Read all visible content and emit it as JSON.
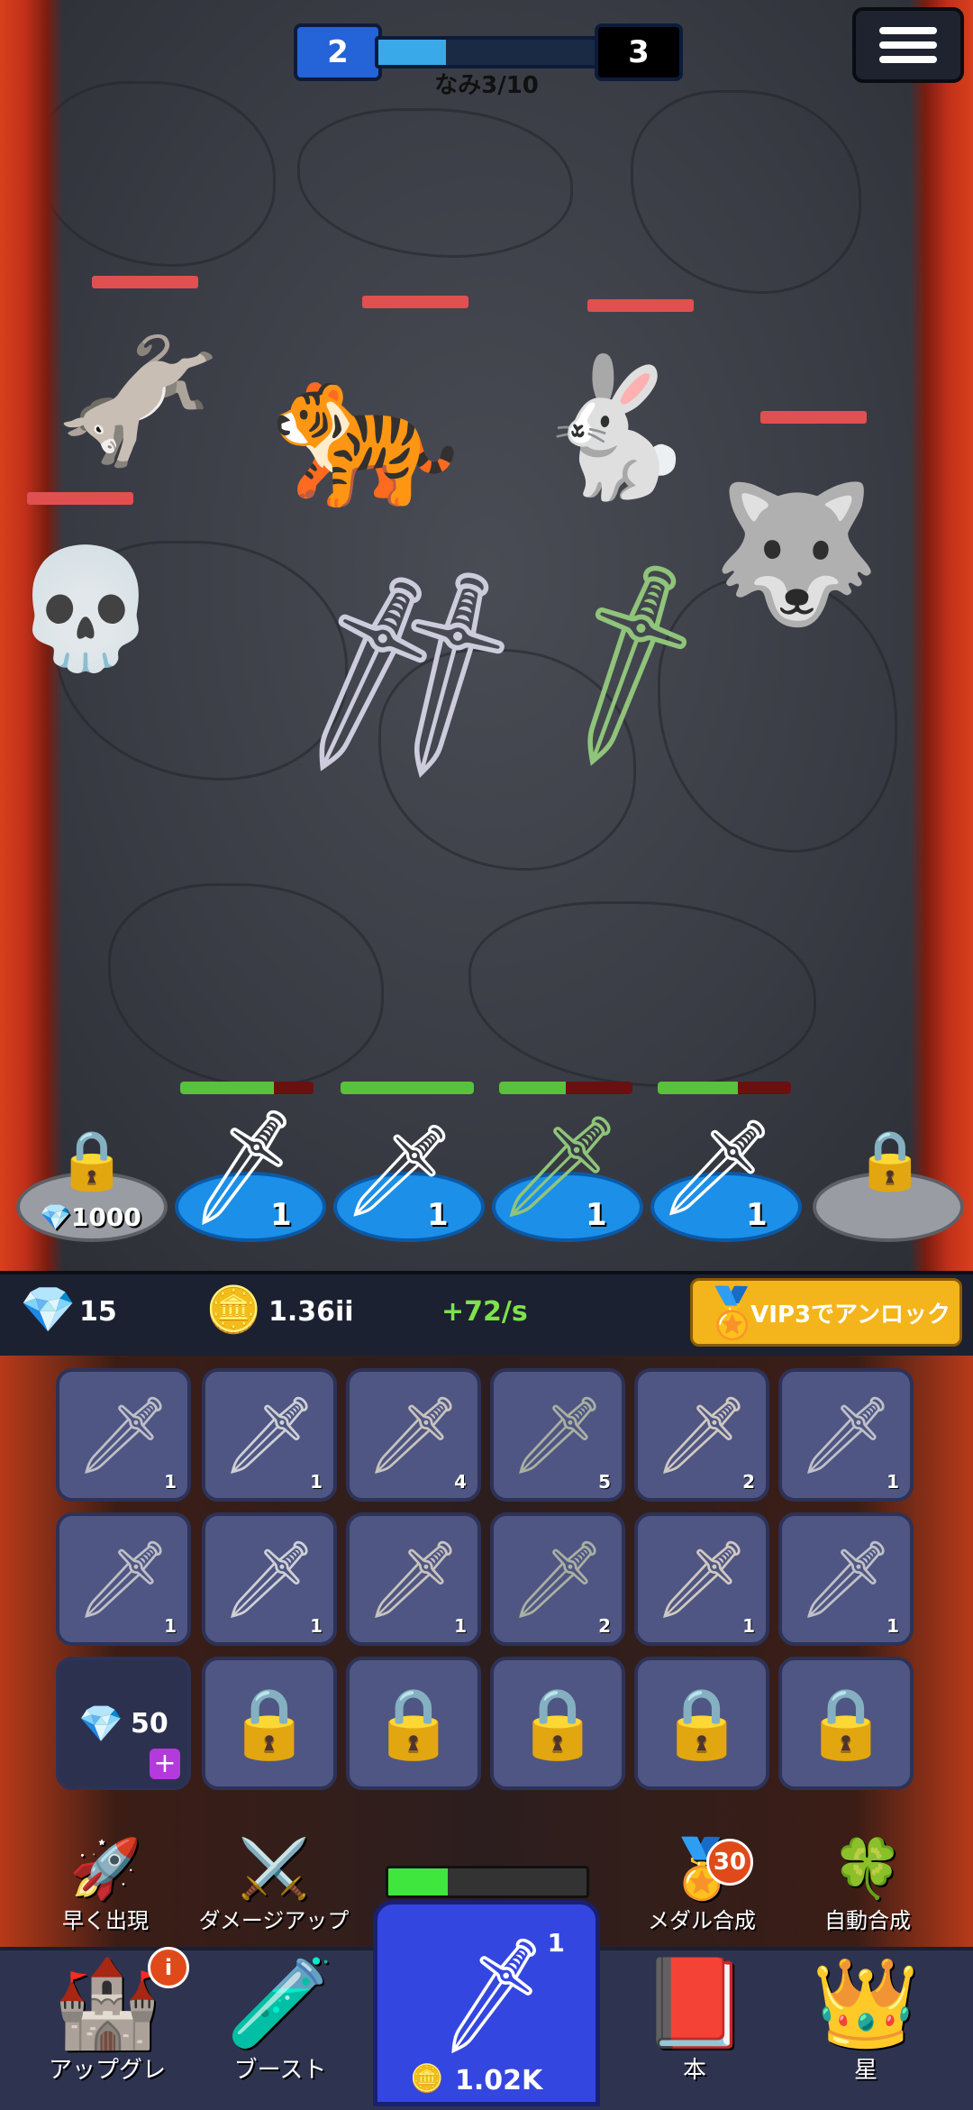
{
  "wave": {
    "current_level": "2",
    "next_level": "3",
    "label": "なみ3/10",
    "progress": 0.3
  },
  "enemies": [
    {
      "name": "donkey",
      "icon": "donkey-icon",
      "hp": 1.0
    },
    {
      "name": "sabertooth-tiger",
      "icon": "tiger-icon",
      "hp": 1.0
    },
    {
      "name": "rabbit",
      "icon": "rabbit-icon",
      "hp": 1.0
    },
    {
      "name": "wolf",
      "icon": "wolf-icon",
      "hp": 1.0
    },
    {
      "name": "viking-skeleton",
      "icon": "skeleton-icon",
      "hp": 1.0
    }
  ],
  "slots": [
    {
      "state": "locked",
      "price": "1000",
      "currency": "gem"
    },
    {
      "state": "weapon",
      "level": "1",
      "hp": 0.7
    },
    {
      "state": "weapon",
      "level": "1",
      "hp": 1.0
    },
    {
      "state": "weapon",
      "level": "1",
      "hp": 0.5
    },
    {
      "state": "weapon",
      "level": "1",
      "hp": 0.6
    },
    {
      "state": "locked"
    }
  ],
  "resources": {
    "gems": "15",
    "coins": "1.36ii",
    "rate": "+72/s",
    "vip_label": "VIP3でアンロック"
  },
  "inventory": {
    "row1": [
      "1",
      "1",
      "4",
      "5",
      "2",
      "1"
    ],
    "row2": [
      "1",
      "1",
      "1",
      "2",
      "1",
      "1"
    ],
    "expand_price": "50",
    "locked_count": 5
  },
  "features": {
    "quick_spawn": "早く出現",
    "damage_up": "ダメージアップ",
    "medal_merge": "メダル合成",
    "medal_badge": "30",
    "auto_merge": "自動合成",
    "progress": 0.3
  },
  "nav": {
    "upgrade": "アップグレ",
    "boost": "ブースト",
    "book": "本",
    "star": "星",
    "buy_level": "1",
    "buy_price": "1.02K",
    "upgrade_badge": "i"
  },
  "colors": {
    "accent": "#3446e0",
    "hp_red": "#e05050",
    "hp_green": "#57c23a",
    "gold": "#f4b41b"
  }
}
